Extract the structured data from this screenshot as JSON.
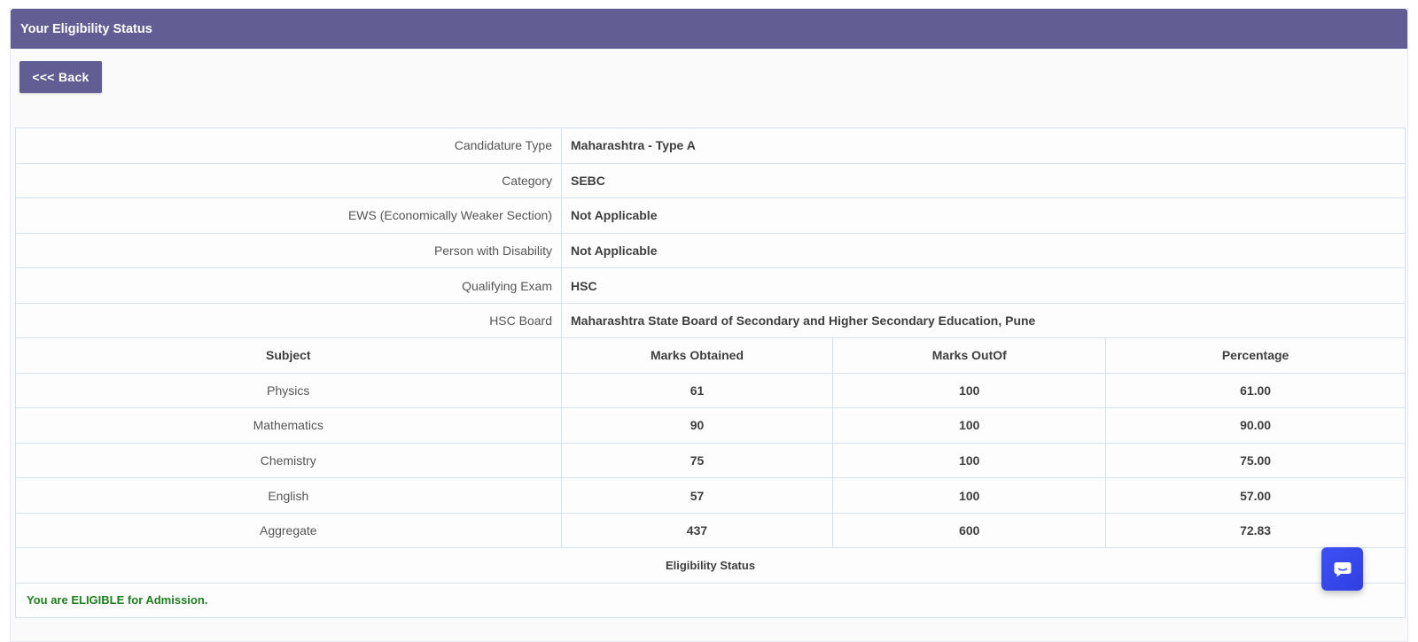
{
  "header": {
    "title": "Your Eligibility Status"
  },
  "back_button": {
    "label": "<<< Back"
  },
  "profile": [
    {
      "label": "Candidature Type",
      "value": "Maharashtra - Type A"
    },
    {
      "label": "Category",
      "value": "SEBC"
    },
    {
      "label": "EWS (Economically Weaker Section)",
      "value": "Not Applicable"
    },
    {
      "label": "Person with Disability",
      "value": "Not Applicable"
    },
    {
      "label": "Qualifying Exam",
      "value": "HSC"
    },
    {
      "label": "HSC Board",
      "value": "Maharashtra State Board of Secondary and Higher Secondary Education, Pune"
    }
  ],
  "marks": {
    "headers": [
      "Subject",
      "Marks Obtained",
      "Marks OutOf",
      "Percentage"
    ],
    "rows": [
      {
        "subject": "Physics",
        "obtained": "61",
        "out_of": "100",
        "percentage": "61.00"
      },
      {
        "subject": "Mathematics",
        "obtained": "90",
        "out_of": "100",
        "percentage": "90.00"
      },
      {
        "subject": "Chemistry",
        "obtained": "75",
        "out_of": "100",
        "percentage": "75.00"
      },
      {
        "subject": "English",
        "obtained": "57",
        "out_of": "100",
        "percentage": "57.00"
      },
      {
        "subject": "Aggregate",
        "obtained": "437",
        "out_of": "600",
        "percentage": "72.83"
      }
    ]
  },
  "eligibility": {
    "heading": "Eligibility Status",
    "message": "You are ELIGIBLE for Admission."
  },
  "chat": {
    "icon": "chat-bubble-icon"
  },
  "colors": {
    "header_bg": "#625e93",
    "eligible_text": "#1e7e1e",
    "chat_bg": "#3f51f5"
  }
}
